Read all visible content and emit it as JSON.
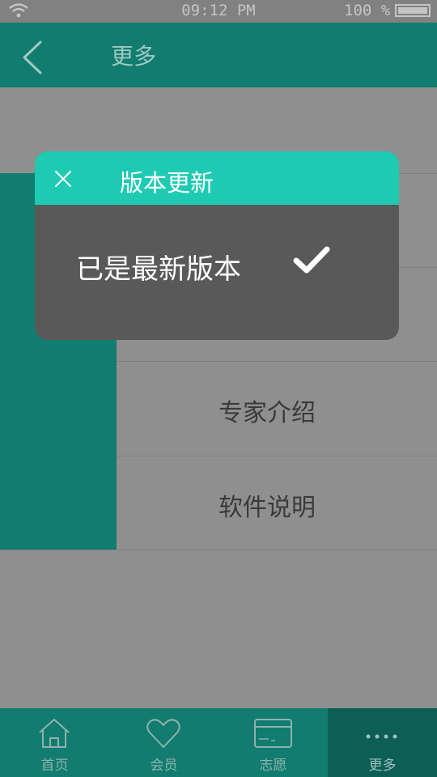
{
  "status_bar": {
    "time": "09:12 PM",
    "battery": "100 %"
  },
  "header": {
    "title": "更多"
  },
  "menu": {
    "items": [
      {
        "label": "专家介绍"
      },
      {
        "label": "软件说明"
      }
    ]
  },
  "dialog": {
    "title": "版本更新",
    "message": "已是最新版本"
  },
  "bottom_nav": {
    "tabs": [
      {
        "label": "首页",
        "icon": "home-icon"
      },
      {
        "label": "会员",
        "icon": "heart-icon"
      },
      {
        "label": "志愿",
        "icon": "card-icon"
      },
      {
        "label": "更多",
        "icon": "more-icon",
        "active": true
      }
    ]
  },
  "colors": {
    "header": "#117c6f",
    "dialog_header": "#1ecbb2",
    "dialog_body": "#595959",
    "overlay": "#8f8f8f"
  }
}
